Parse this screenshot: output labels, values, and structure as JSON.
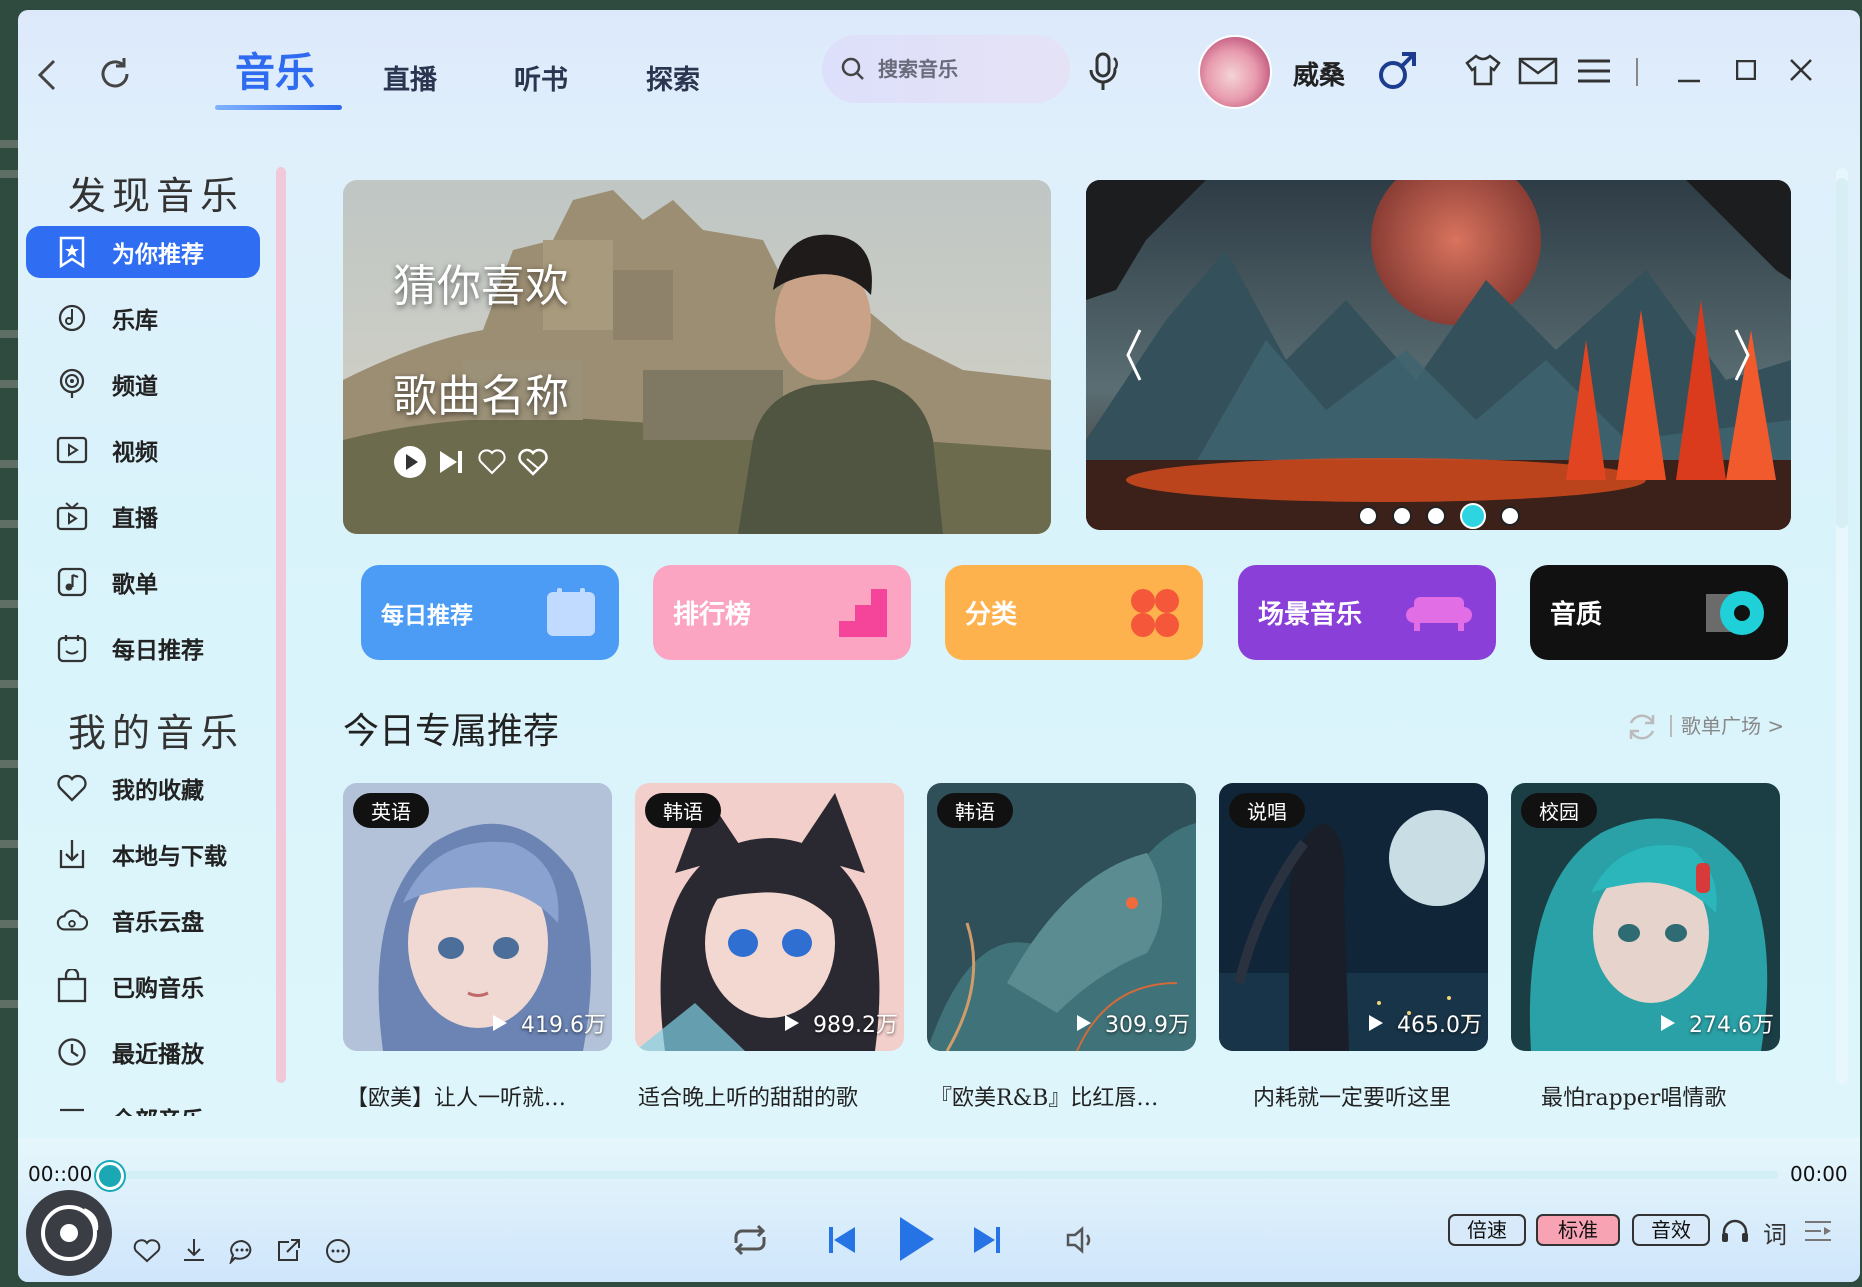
{
  "header": {
    "tabs": [
      {
        "label": "音乐",
        "active": true
      },
      {
        "label": "直播"
      },
      {
        "label": "听书"
      },
      {
        "label": "探索"
      }
    ],
    "search_placeholder": "搜索音乐",
    "username": "威桑",
    "gender_icon": "male-icon"
  },
  "sidebar": {
    "discover_heading": "发现音乐",
    "discover_items": [
      {
        "label": "为你推荐",
        "icon": "star-bookmark-icon",
        "active": true
      },
      {
        "label": "乐库",
        "icon": "music-disc-icon"
      },
      {
        "label": "频道",
        "icon": "radio-channel-icon"
      },
      {
        "label": "视频",
        "icon": "video-play-icon"
      },
      {
        "label": "直播",
        "icon": "tv-live-icon"
      },
      {
        "label": "歌单",
        "icon": "playlist-note-icon"
      },
      {
        "label": "每日推荐",
        "icon": "calendar-icon"
      }
    ],
    "mymusic_heading": "我的音乐",
    "mymusic_items": [
      {
        "label": "我的收藏",
        "icon": "heart-icon"
      },
      {
        "label": "本地与下载",
        "icon": "download-icon"
      },
      {
        "label": "音乐云盘",
        "icon": "cloud-icon"
      },
      {
        "label": "已购音乐",
        "icon": "shopping-bag-icon"
      },
      {
        "label": "最近播放",
        "icon": "clock-icon"
      },
      {
        "label": "全部音乐",
        "icon": "list-icon"
      }
    ]
  },
  "banner_left": {
    "line1": "猜你喜欢",
    "line2": "歌曲名称"
  },
  "banner_right": {
    "dots": 5,
    "active_dot": 4
  },
  "quick_cards": [
    {
      "label": "每日推荐",
      "color": "#4c9cf6"
    },
    {
      "label": "排行榜",
      "color": "#fba5c3"
    },
    {
      "label": "分类",
      "color": "#fdb24d"
    },
    {
      "label": "场景音乐",
      "color": "#8a3fd8"
    },
    {
      "label": "音质",
      "color": "#111111"
    }
  ],
  "section": {
    "title": "今日专属推荐",
    "more_link": "歌单广场 >"
  },
  "playlists": [
    {
      "tag": "英语",
      "plays": "419.6万",
      "title": "【欧美】让人一听就…"
    },
    {
      "tag": "韩语",
      "plays": "989.2万",
      "title": "适合晚上听的甜甜的歌"
    },
    {
      "tag": "韩语",
      "plays": "309.9万",
      "title": "『欧美R&B』比红唇…"
    },
    {
      "tag": "说唱",
      "plays": "465.0万",
      "title": "内耗就一定要听这里"
    },
    {
      "tag": "校园",
      "plays": "274.6万",
      "title": "最怕rapper唱情歌"
    }
  ],
  "player": {
    "time_current": "00::00",
    "time_total": "00:00",
    "progress": 0,
    "speed_label": "倍速",
    "quality_label": "标准",
    "effect_label": "音效",
    "lyrics_label": "词"
  }
}
